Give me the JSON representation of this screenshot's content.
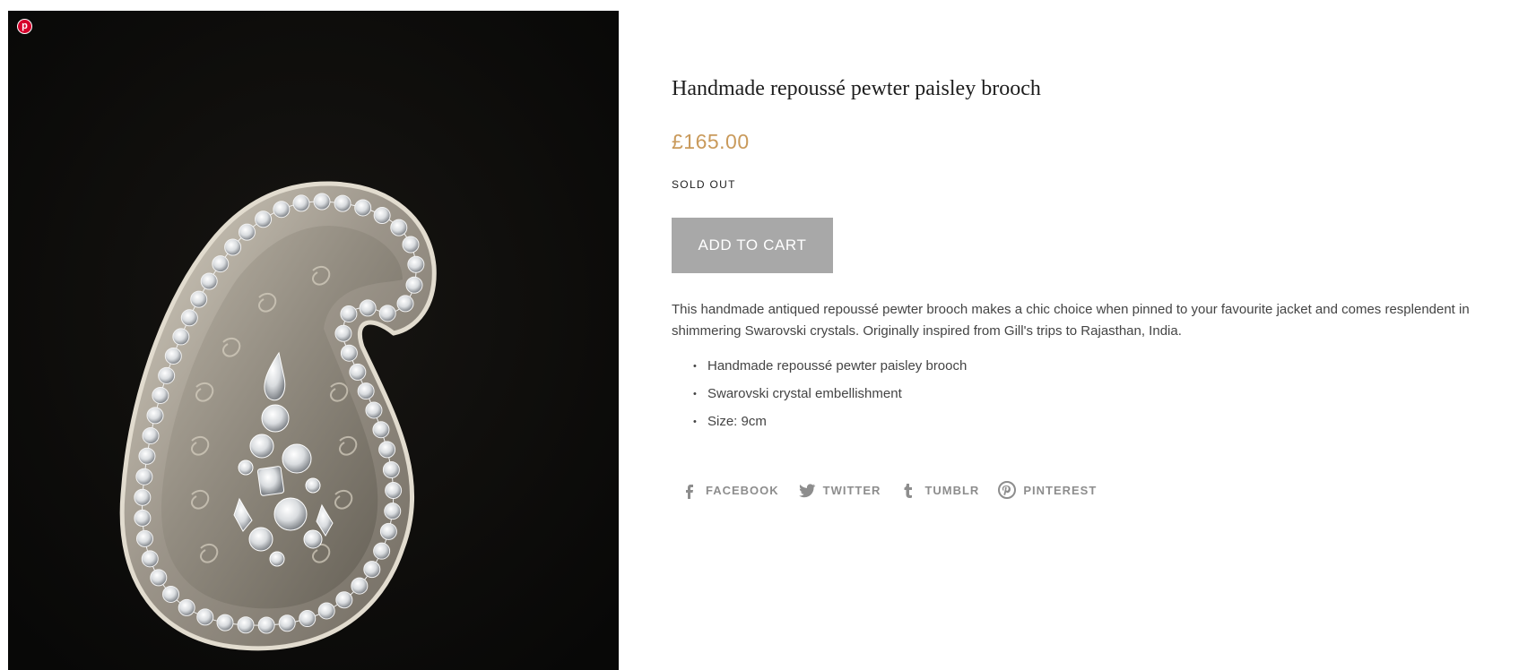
{
  "gallery": {
    "image_alt": "Handmade repoussé pewter paisley brooch on black velvet",
    "pin_icon": "pinterest-icon"
  },
  "product": {
    "title": "Handmade repoussé pewter paisley brooch",
    "price": "£165.00",
    "availability": "SOLD OUT",
    "add_to_cart_label": "ADD TO CART",
    "description": "This handmade antiqued repoussé pewter brooch makes a chic choice when pinned to your favourite jacket and comes resplendent in shimmering Swarovski crystals. Originally inspired from Gill's trips to Rajasthan, India.",
    "features": [
      "Handmade repoussé pewter paisley brooch",
      "Swarovski crystal embellishment",
      "Size: 9cm"
    ]
  },
  "share": [
    {
      "label": "FACEBOOK",
      "icon": "facebook-icon"
    },
    {
      "label": "TWITTER",
      "icon": "twitter-icon"
    },
    {
      "label": "TUMBLR",
      "icon": "tumblr-icon"
    },
    {
      "label": "PINTEREST",
      "icon": "pinterest-icon"
    }
  ],
  "colors": {
    "price": "#c99a5b",
    "button_disabled": "#a8a8a8",
    "share_text": "#8d8d8d",
    "pin_red": "#d5002a"
  }
}
